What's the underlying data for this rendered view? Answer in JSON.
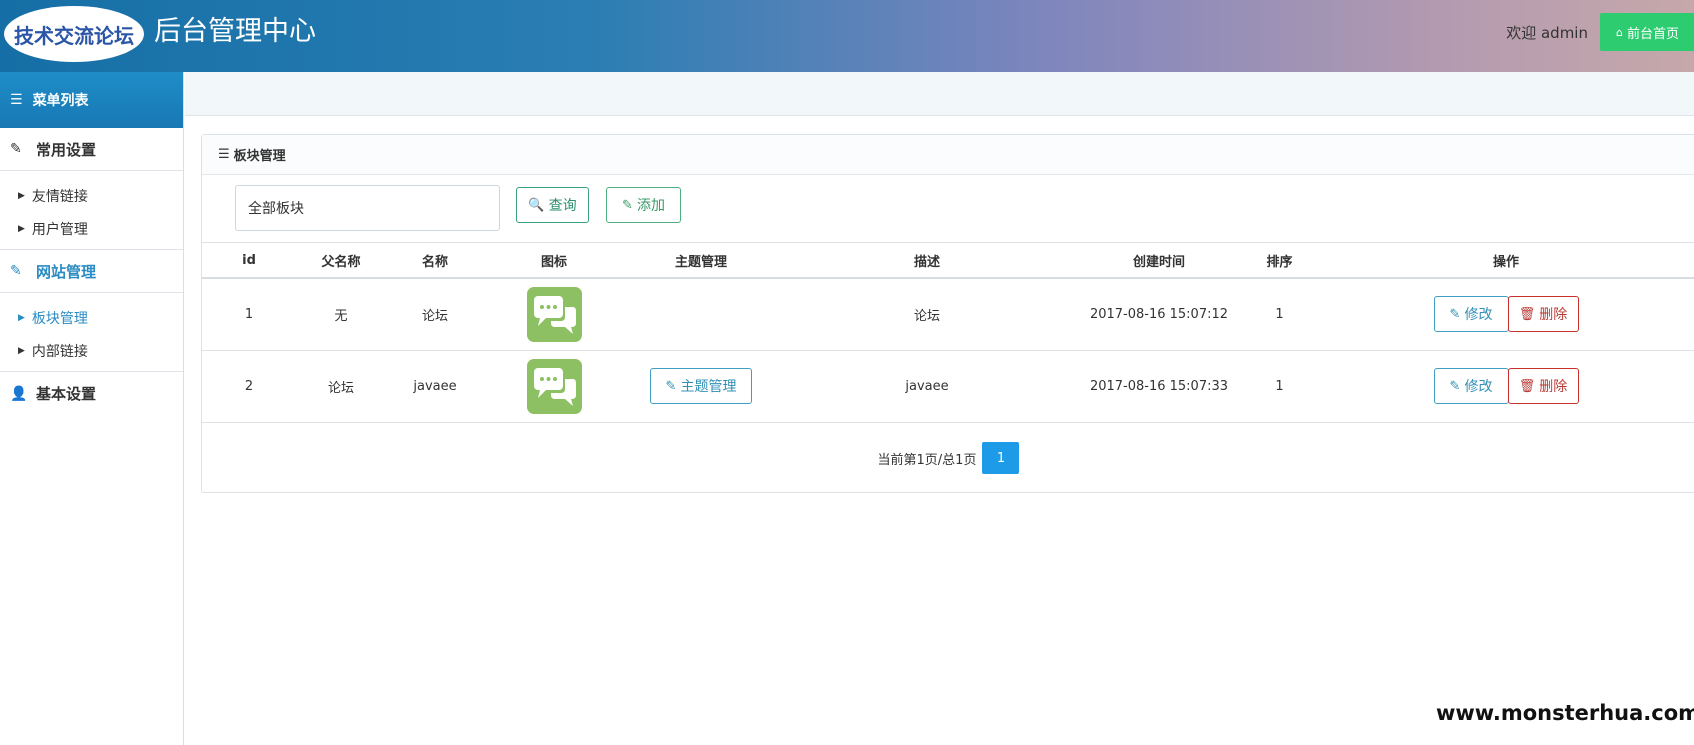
{
  "header": {
    "logo_text": "技术交流论坛",
    "title": "后台管理中心",
    "welcome": "欢迎 admin",
    "home_button": "前台首页"
  },
  "sidebar": {
    "menu_title": "菜单列表",
    "groups": [
      {
        "label": "常用设置",
        "items": [
          "友情链接",
          "用户管理"
        ]
      },
      {
        "label": "网站管理",
        "items": [
          "板块管理",
          "内部链接"
        ]
      },
      {
        "label": "基本设置",
        "items": []
      }
    ]
  },
  "panel": {
    "title": "板块管理",
    "select_value": "全部板块",
    "query_label": "查询",
    "add_label": "添加"
  },
  "table": {
    "headers": [
      "id",
      "父名称",
      "名称",
      "图标",
      "主题管理",
      "描述",
      "创建时间",
      "排序",
      "操作"
    ],
    "rows": [
      {
        "id": "1",
        "parent": "无",
        "name": "论坛",
        "topic_button": "",
        "desc": "论坛",
        "created": "2017-08-16 15:07:12",
        "order": "1",
        "edit": "修改",
        "delete": "删除"
      },
      {
        "id": "2",
        "parent": "论坛",
        "name": "javaee",
        "topic_button": "主题管理",
        "desc": "javaee",
        "created": "2017-08-16 15:07:33",
        "order": "1",
        "edit": "修改",
        "delete": "删除"
      }
    ]
  },
  "pager": {
    "text": "当前第1页/总1页",
    "current": "1"
  },
  "watermark": "www.monsterhua.com",
  "colors": {
    "accent": "#1e9be8",
    "success": "#2ecc71",
    "danger": "#c9302c",
    "icon_green": "#8cc063"
  }
}
